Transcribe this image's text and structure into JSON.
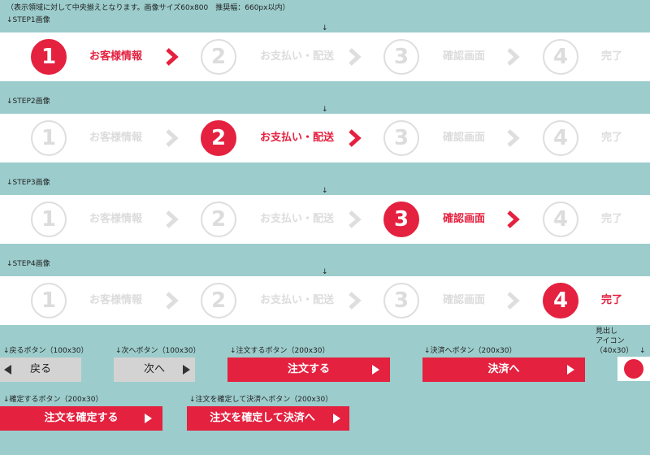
{
  "header_note": "（表示領域に対して中央揃えとなります。画像サイズ60x800　推奨幅：660px以内）",
  "center_mark": "↓",
  "step_labels": [
    "お客様情報",
    "お支払い・配送",
    "確認画面",
    "完了"
  ],
  "step_numbers": [
    "1",
    "2",
    "3",
    "4"
  ],
  "rows": [
    {
      "caption": "↓STEP1画像",
      "active_step": 1
    },
    {
      "caption": "↓STEP2画像",
      "active_step": 2
    },
    {
      "caption": "↓STEP3画像",
      "active_step": 3
    },
    {
      "caption": "↓STEP4画像",
      "active_step": 4
    }
  ],
  "buttons": {
    "back": {
      "caption": "↓戻るボタン（100x30）",
      "label": "戻る"
    },
    "next": {
      "caption": "↓次へボタン（100x30）",
      "label": "次へ"
    },
    "order": {
      "caption": "↓注文するボタン（200x30）",
      "label": "注文する"
    },
    "payment": {
      "caption": "↓決済へボタン（200x30）",
      "label": "決済へ"
    },
    "confirm": {
      "caption": "↓確定するボタン（200x30）",
      "label": "注文を確定する"
    },
    "confirm_pay": {
      "caption": "↓注文を確定して決済へボタン（200x30）",
      "label": "注文を確定して決済へ"
    }
  },
  "heading_icon": {
    "caption_line1": "見出し",
    "caption_line2": "アイコン",
    "caption_line3": "（40x30）",
    "caption_arrow": "↓",
    "icon": "red-dot-icon"
  },
  "colors": {
    "accent": "#e4213f",
    "background": "#9ccccc",
    "inactive": "#dcdcdc"
  }
}
